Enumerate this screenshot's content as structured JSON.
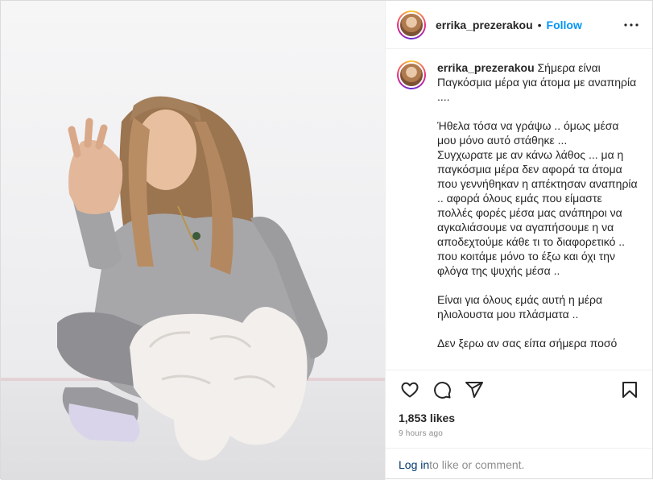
{
  "post": {
    "username": "errika_prezerakou",
    "separator": "•",
    "follow_label": "Follow",
    "caption_username": "errika_prezerakou",
    "caption_text": " Σήμερα είναι Παγκόσμια μέρα για άτομα με αναπηρία ....\n\nΉθελα τόσα να γράψω .. όμως μέσα μου μόνο αυτό στάθηκε ...\nΣυγχωρατε με αν κάνω λάθος ... μα η παγκόσμια μέρα δεν αφορά τα άτομα που γεννήθηκαν η απέκτησαν αναπηρία .. αφορά όλους εμάς που είμαστε πολλές φορές μέσα μας ανάπηροι να αγκαλιάσουμε να αγαπήσουμε η να αποδεχτούμε κάθε τι το διαφορετικό .. που κοιτάμε μόνο το έξω και όχι την φλόγα της ψυχής μέσα ..\n\nΕίναι για όλους εμάς αυτή η μέρα ηλιολουστα μου πλάσματα ..\n\nΔεν ξερω αν σας είπα σήμερα ποσό",
    "likes": "1,853 likes",
    "time": "9 hours ago",
    "login_link": "Log in",
    "login_text": " to like or comment."
  },
  "icons": {
    "more": "more-options-icon",
    "like": "heart-icon",
    "comment": "comment-icon",
    "share": "share-icon",
    "save": "bookmark-icon"
  },
  "colors": {
    "follow": "#0095f6",
    "text": "#262626",
    "muted": "#8e8e8e",
    "link": "#00376b"
  }
}
